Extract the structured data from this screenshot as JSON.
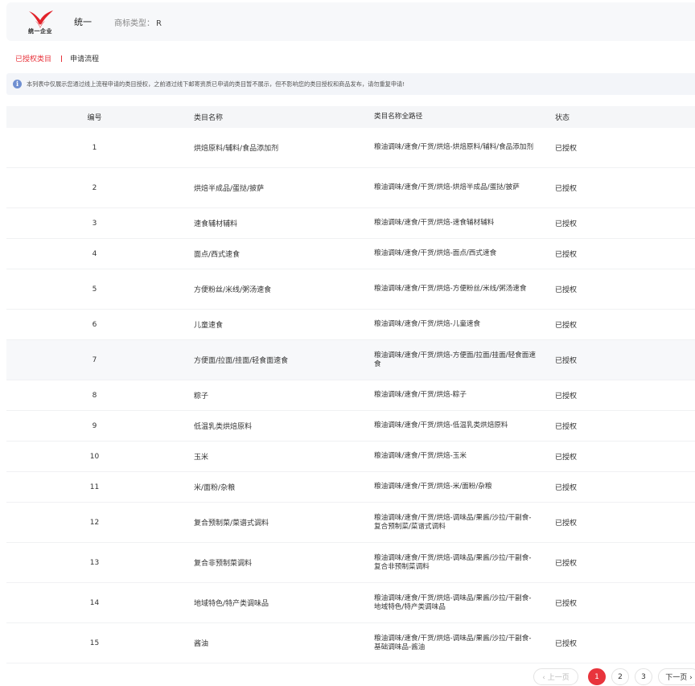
{
  "header": {
    "logo_text": "统一企业",
    "brand_name": "统一",
    "trademark_label": "商标类型：",
    "trademark_value": "R"
  },
  "tabs": [
    {
      "label": "已授权类目",
      "active": true
    },
    {
      "label": "申请流程",
      "active": false
    }
  ],
  "notice": {
    "text": "本列表中仅展示您通过线上流程申请的类目授权，之前通过线下邮寄资质已申请的类目暂不展示，但不影响您的类目授权和商品发布，请勿重复申请!"
  },
  "table": {
    "columns": [
      "编号",
      "类目名称",
      "类目名称全路径",
      "状态"
    ],
    "rows": [
      {
        "id": "1",
        "name": "烘焙原料/辅料/食品添加剂",
        "path": "粮油调味/速食/干货/烘焙-烘焙原料/辅料/食品添加剂",
        "status": "已授权"
      },
      {
        "id": "2",
        "name": "烘焙半成品/蛋挞/披萨",
        "path": "粮油调味/速食/干货/烘焙-烘焙半成品/蛋挞/披萨",
        "status": "已授权"
      },
      {
        "id": "3",
        "name": "速食辅材辅料",
        "path": "粮油调味/速食/干货/烘焙-速食辅材辅料",
        "status": "已授权"
      },
      {
        "id": "4",
        "name": "面点/西式速食",
        "path": "粮油调味/速食/干货/烘焙-面点/西式速食",
        "status": "已授权"
      },
      {
        "id": "5",
        "name": "方便粉丝/米线/粥汤速食",
        "path": "粮油调味/速食/干货/烘焙-方便粉丝/米线/粥汤速食",
        "status": "已授权"
      },
      {
        "id": "6",
        "name": "儿童速食",
        "path": "粮油调味/速食/干货/烘焙-儿童速食",
        "status": "已授权"
      },
      {
        "id": "7",
        "name": "方便面/拉面/挂面/轻食面速食",
        "path": "粮油调味/速食/干货/烘焙-方便面/拉面/挂面/轻食面速食",
        "status": "已授权"
      },
      {
        "id": "8",
        "name": "粽子",
        "path": "粮油调味/速食/干货/烘焙-粽子",
        "status": "已授权"
      },
      {
        "id": "9",
        "name": "低温乳类烘焙原料",
        "path": "粮油调味/速食/干货/烘焙-低温乳类烘焙原料",
        "status": "已授权"
      },
      {
        "id": "10",
        "name": "玉米",
        "path": "粮油调味/速食/干货/烘焙-玉米",
        "status": "已授权"
      },
      {
        "id": "11",
        "name": "米/面粉/杂粮",
        "path": "粮油调味/速食/干货/烘焙-米/面粉/杂粮",
        "status": "已授权"
      },
      {
        "id": "12",
        "name": "复合预制菜/菜谱式调料",
        "path": "粮油调味/速食/干货/烘焙-调味品/果酱/沙拉/干副食-复合预制菜/菜谱式调料",
        "status": "已授权"
      },
      {
        "id": "13",
        "name": "复合非预制菜调料",
        "path": "粮油调味/速食/干货/烘焙-调味品/果酱/沙拉/干副食-复合非预制菜调料",
        "status": "已授权"
      },
      {
        "id": "14",
        "name": "地域特色/特产类调味品",
        "path": "粮油调味/速食/干货/烘焙-调味品/果酱/沙拉/干副食-地域特色/特产类调味品",
        "status": "已授权"
      },
      {
        "id": "15",
        "name": "酱油",
        "path": "粮油调味/速食/干货/烘焙-调味品/果酱/沙拉/干副食-基础调味品-酱油",
        "status": "已授权"
      }
    ]
  },
  "pagination": {
    "prev_label": "‹ 上一页",
    "pages": [
      "1",
      "2",
      "3"
    ],
    "current_page": "1",
    "next_label": "下一页 ›"
  },
  "colors": {
    "accent": "#e8343c",
    "info": "#6f8fd1"
  }
}
